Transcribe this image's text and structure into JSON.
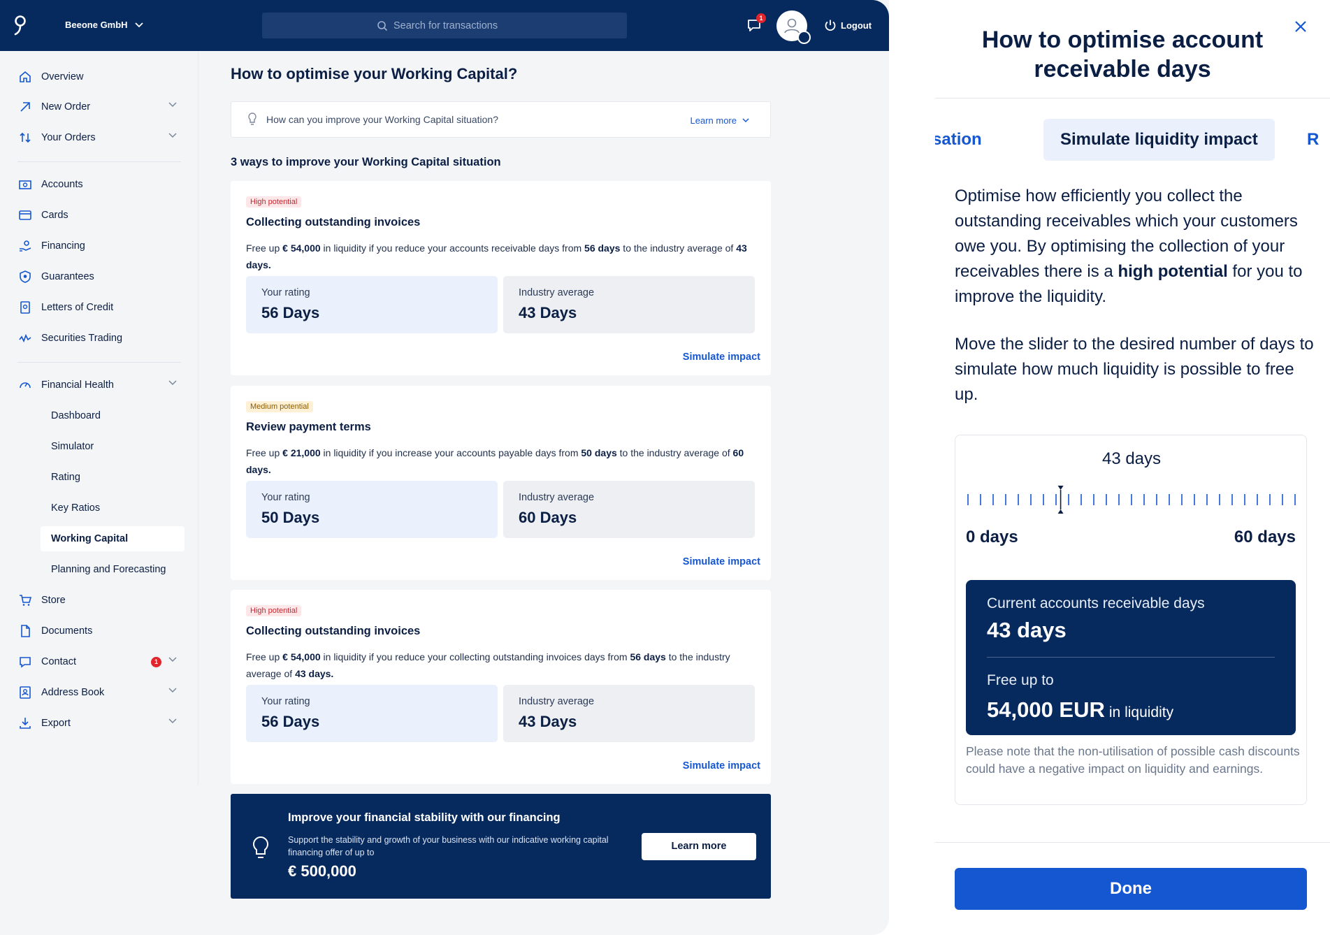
{
  "topbar": {
    "company": "Beeone GmbH",
    "search_placeholder": "Search for transactions",
    "notification_count": "1",
    "logout_label": "Logout"
  },
  "sidebar": {
    "items": [
      {
        "label": "Overview",
        "icon": "home-icon"
      },
      {
        "label": "New Order",
        "icon": "arrow-up-right-icon"
      },
      {
        "label": "Your Orders",
        "icon": "arrows-up-down-icon"
      },
      {
        "label": "Accounts",
        "icon": "account-icon"
      },
      {
        "label": "Cards",
        "icon": "card-icon"
      },
      {
        "label": "Financing",
        "icon": "financing-icon"
      },
      {
        "label": "Guarantees",
        "icon": "shield-icon"
      },
      {
        "label": "Letters of Credit",
        "icon": "document-lock-icon"
      },
      {
        "label": "Securities Trading",
        "icon": "chart-line-icon"
      },
      {
        "label": "Financial Health",
        "icon": "gauge-icon"
      },
      {
        "label": "Store",
        "icon": "cart-icon"
      },
      {
        "label": "Documents",
        "icon": "document-icon"
      },
      {
        "label": "Contact",
        "icon": "chat-icon"
      },
      {
        "label": "Address Book",
        "icon": "address-book-icon"
      },
      {
        "label": "Export",
        "icon": "download-icon"
      }
    ],
    "sub_items": [
      "Dashboard",
      "Simulator",
      "Rating",
      "Key Ratios",
      "Working Capital",
      "Planning and Forecasting"
    ],
    "active_sub": "Working Capital",
    "contact_badge": "1"
  },
  "main": {
    "title": "How to optimise your Working Capital?",
    "hint": "How can you improve your Working Capital situation?",
    "learn_more": "Learn more",
    "section_title": "3 ways to improve your Working Capital situation",
    "cards": [
      {
        "pill": "High potential",
        "title": "Collecting outstanding invoices",
        "desc_1": "Free up ",
        "desc_amount": "€ 54,000",
        "desc_2": " in liquidity if you reduce your accounts receivable days from ",
        "desc_from": "56 days",
        "desc_3": " to the industry average of ",
        "desc_to": "43 days.",
        "rating_label": "Your rating",
        "rating_value": "56 Days",
        "industry_label": "Industry average",
        "industry_value": "43 Days",
        "simulate": "Simulate impact"
      },
      {
        "pill": "Medium potential",
        "title": "Review payment terms",
        "desc_1": "Free up ",
        "desc_amount": "€ 21,000",
        "desc_2": " in liquidity if you increase your accounts payable days from ",
        "desc_from": "50 days",
        "desc_3": " to the industry average of ",
        "desc_to": "60 days.",
        "rating_label": "Your rating",
        "rating_value": "50 Days",
        "industry_label": "Industry average",
        "industry_value": "60 Days",
        "simulate": "Simulate impact"
      },
      {
        "pill": "High potential",
        "title": "Collecting outstanding invoices",
        "desc_1": "Free up ",
        "desc_amount": "€ 54,000",
        "desc_2": " in liquidity if you reduce your collecting outstanding invoices days from ",
        "desc_from": "56 days",
        "desc_3": " to the industry average of ",
        "desc_to": "43 days.",
        "rating_label": "Your rating",
        "rating_value": "56 Days",
        "industry_label": "Industry average",
        "industry_value": "43 Days",
        "simulate": "Simulate impact"
      }
    ],
    "banner": {
      "title": "Improve your financial stability with our financing",
      "desc": "Support the stability and growth of your business with our indicative working capital financing offer of up to",
      "amount": "€ 500,000",
      "button": "Learn more"
    }
  },
  "panel": {
    "title": "How to optimise account receivable days",
    "tabs": [
      "sation",
      "Simulate liquidity impact",
      "R"
    ],
    "p1_a": "Optimise how efficiently you collect the outstanding receivables which your customers owe you. By optimising the collection of your receivables there is a ",
    "p1_b": "high potential",
    "p1_c": " for you to improve the liquidity.",
    "p2": "Move the slider to the desired number of days to simulate how much liquidity is possible to free up.",
    "slider": {
      "value_label": "43 days",
      "value": 43,
      "min": 0,
      "max": 60,
      "min_label": "0 days",
      "max_label": "60 days"
    },
    "result": {
      "label": "Current accounts receivable days",
      "value": "43 days",
      "label2": "Free up to",
      "amount": "54,000 EUR",
      "suffix": "in liquidity"
    },
    "note": "Please note that the non-utilisation of possible cash discounts could have a negative impact on liquidity and earnings.",
    "done": "Done"
  },
  "colors": {
    "navy": "#072a5e",
    "accent": "#1556d1",
    "high_pill": "#fde7e8",
    "medium_pill": "#fdf0d5"
  }
}
